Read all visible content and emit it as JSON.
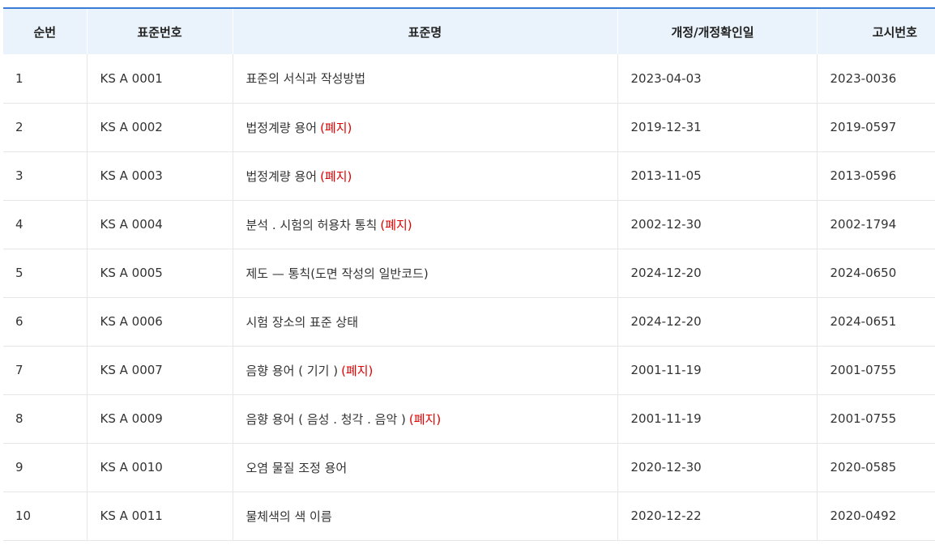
{
  "table": {
    "headers": {
      "index": "순번",
      "standard_no": "표준번호",
      "standard_name": "표준명",
      "revision_date": "개정/개정확인일",
      "notice_no": "고시번호"
    },
    "rows": [
      {
        "index": "1",
        "standard_no": "KS A 0001",
        "standard_name": "표준의 서식과 작성방법",
        "status": "",
        "revision_date": "2023-04-03",
        "notice_no": "2023-0036"
      },
      {
        "index": "2",
        "standard_no": "KS A 0002",
        "standard_name": "법정계량 용어",
        "status": "(폐지)",
        "revision_date": "2019-12-31",
        "notice_no": "2019-0597"
      },
      {
        "index": "3",
        "standard_no": "KS A 0003",
        "standard_name": "법정계량 용어",
        "status": "(폐지)",
        "revision_date": "2013-11-05",
        "notice_no": "2013-0596"
      },
      {
        "index": "4",
        "standard_no": "KS A 0004",
        "standard_name": "분석 . 시험의 허용차 통칙",
        "status": "(폐지)",
        "revision_date": "2002-12-30",
        "notice_no": "2002-1794"
      },
      {
        "index": "5",
        "standard_no": "KS A 0005",
        "standard_name": "제도 — 통칙(도면 작성의 일반코드)",
        "status": "",
        "revision_date": "2024-12-20",
        "notice_no": "2024-0650"
      },
      {
        "index": "6",
        "standard_no": "KS A 0006",
        "standard_name": "시험 장소의 표준 상태",
        "status": "",
        "revision_date": "2024-12-20",
        "notice_no": "2024-0651"
      },
      {
        "index": "7",
        "standard_no": "KS A 0007",
        "standard_name": "음향 용어 ( 기기 )",
        "status": "(폐지)",
        "revision_date": "2001-11-19",
        "notice_no": "2001-0755"
      },
      {
        "index": "8",
        "standard_no": "KS A 0009",
        "standard_name": "음향 용어 ( 음성 . 청각 . 음악 )",
        "status": "(폐지)",
        "revision_date": "2001-11-19",
        "notice_no": "2001-0755"
      },
      {
        "index": "9",
        "standard_no": "KS A 0010",
        "standard_name": "오염 물질 조정 용어",
        "status": "",
        "revision_date": "2020-12-30",
        "notice_no": "2020-0585"
      },
      {
        "index": "10",
        "standard_no": "KS A 0011",
        "standard_name": "물체색의 색 이름",
        "status": "",
        "revision_date": "2020-12-22",
        "notice_no": "2020-0492"
      }
    ]
  },
  "colors": {
    "header_bg": "#eaf3fb",
    "header_border": "#3a7bd5",
    "abolished_text": "#e00000",
    "row_border": "#e6e6e6"
  }
}
